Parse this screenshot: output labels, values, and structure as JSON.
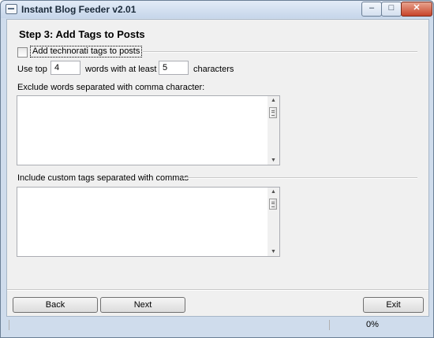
{
  "window": {
    "title": "Instant Blog Feeder v2.01",
    "controls": {
      "minimize": "–",
      "maximize": "□",
      "close": "✕"
    }
  },
  "step": {
    "heading": "Step 3: Add Tags to Posts",
    "technorati": {
      "label": "Add technorati tags to posts",
      "checked": false
    },
    "use_top_label": "Use top",
    "top_count": "4",
    "words_with_label": "words with at least",
    "min_chars": "5",
    "characters_label": "characters",
    "exclude_label": "Exclude words separated with comma character:",
    "exclude_value": "",
    "custom_label": "Include custom tags separated with commas",
    "custom_value": ""
  },
  "buttons": {
    "back": "Back",
    "next": "Next",
    "exit": "Exit"
  },
  "status": {
    "progress_text": "0%",
    "progress": 0
  },
  "icons": {
    "app": "window-icon",
    "scroll_up": "scroll-up-arrow-icon",
    "scroll_down": "scroll-down-arrow-icon"
  },
  "colors": {
    "frame": "#cfdcec",
    "close_button": "#c7432a",
    "client_bg": "#f0f0f0"
  }
}
